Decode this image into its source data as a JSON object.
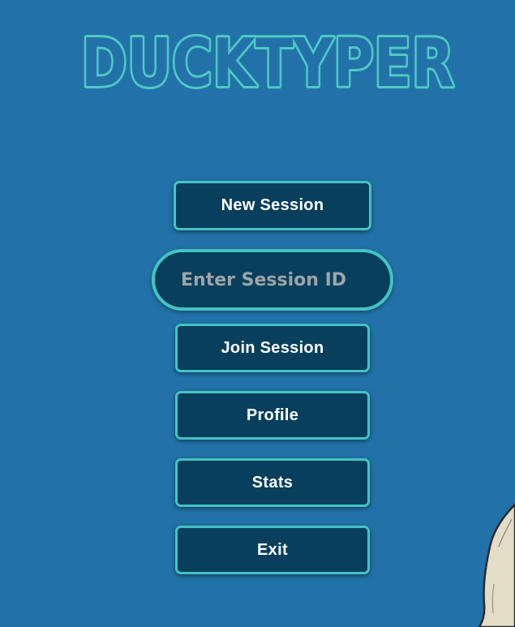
{
  "app": {
    "title": "DUCKTYPER"
  },
  "menu": {
    "new_session": "New Session",
    "session_id_placeholder": "Enter Session ID",
    "session_id_value": "",
    "join_session": "Join Session",
    "profile": "Profile",
    "stats": "Stats",
    "exit": "Exit"
  },
  "colors": {
    "background": "#2272a9",
    "button_fill": "#083f5c",
    "accent": "#44c3c3",
    "logo": "#4ec9c4",
    "placeholder": "#9da4a8"
  },
  "icons": {
    "logo": "ducktyper-logo",
    "mascot": "duck-mascot"
  }
}
